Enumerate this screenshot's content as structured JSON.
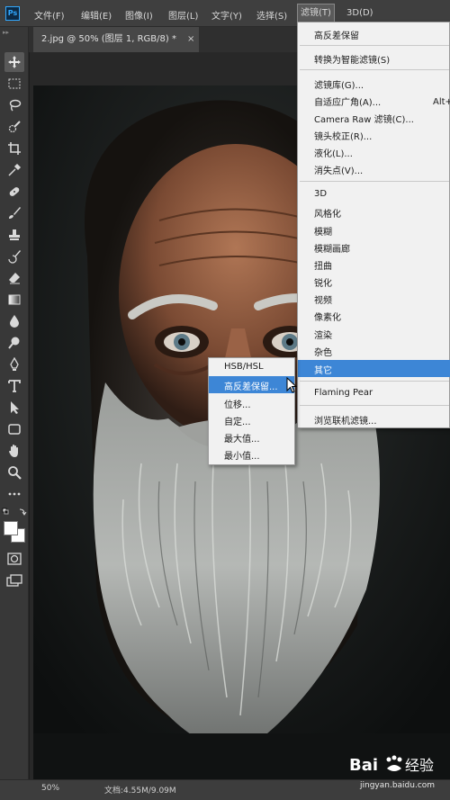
{
  "app": {
    "logo": "Ps"
  },
  "menubar": {
    "items": [
      "文件(F)",
      "编辑(E)",
      "图像(I)",
      "图层(L)",
      "文字(Y)",
      "选择(S)",
      "滤镜(T)",
      "3D(D)"
    ],
    "active": "滤镜(T)"
  },
  "document_tab": {
    "title": "2.jpg @ 50% (图层 1, RGB/8) *",
    "close_label": "×"
  },
  "toolbar": {
    "grip": "▸▸",
    "tools": [
      {
        "name": "move-tool-icon",
        "selected": true
      },
      {
        "name": "marquee-tool-icon"
      },
      {
        "name": "lasso-tool-icon"
      },
      {
        "name": "quick-selection-tool-icon"
      },
      {
        "name": "crop-tool-icon"
      },
      {
        "name": "eyedropper-tool-icon"
      },
      {
        "name": "healing-brush-tool-icon"
      },
      {
        "name": "brush-tool-icon"
      },
      {
        "name": "clone-stamp-tool-icon"
      },
      {
        "name": "history-brush-tool-icon"
      },
      {
        "name": "eraser-tool-icon"
      },
      {
        "name": "gradient-tool-icon"
      },
      {
        "name": "blur-tool-icon"
      },
      {
        "name": "dodge-tool-icon"
      },
      {
        "name": "pen-tool-icon"
      },
      {
        "name": "type-tool-icon"
      },
      {
        "name": "path-selection-tool-icon"
      },
      {
        "name": "rectangle-tool-icon"
      },
      {
        "name": "hand-tool-icon"
      },
      {
        "name": "zoom-tool-icon"
      },
      {
        "name": "more-tools-icon"
      }
    ]
  },
  "filter_menu": {
    "items": [
      "高反差保留",
      "转换为智能滤镜(S)",
      "滤镜库(G)...",
      "自适应广角(A)...",
      "Camera Raw 滤镜(C)...",
      "镜头校正(R)...",
      "液化(L)...",
      "消失点(V)...",
      "3D",
      "风格化",
      "模糊",
      "模糊画廊",
      "扭曲",
      "锐化",
      "视频",
      "像素化",
      "渲染",
      "杂色",
      "其它",
      "Flaming Pear",
      "浏览联机滤镜..."
    ],
    "shortcut": "Alt+",
    "highlighted": "其它"
  },
  "other_submenu": {
    "items": [
      "HSB/HSL",
      "高反差保留...",
      "位移...",
      "自定...",
      "最大值...",
      "最小值..."
    ],
    "highlighted": "高反差保留..."
  },
  "statusbar": {
    "zoom": "50%",
    "doc_info": "文档:4.55M/9.09M"
  },
  "watermark": {
    "url": "jingyan.baidu.com",
    "brand": "Bai 经验"
  }
}
